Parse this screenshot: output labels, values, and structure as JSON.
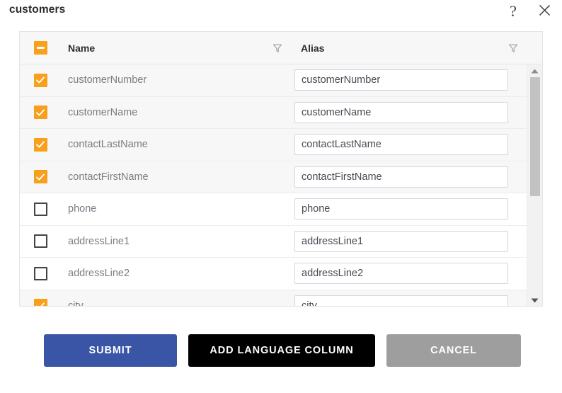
{
  "dialog": {
    "title": "customers",
    "help_icon": "question-mark-icon",
    "help_glyph": "?",
    "close_icon": "close-icon"
  },
  "table": {
    "select_all_state": "indeterminate",
    "columns": [
      {
        "key": "name",
        "label": "Name",
        "filter_icon": "filter-funnel-icon"
      },
      {
        "key": "alias",
        "label": "Alias",
        "filter_icon": "filter-funnel-icon"
      }
    ],
    "rows": [
      {
        "checked": true,
        "name": "customerNumber",
        "alias": "customerNumber"
      },
      {
        "checked": true,
        "name": "customerName",
        "alias": "customerName"
      },
      {
        "checked": true,
        "name": "contactLastName",
        "alias": "contactLastName"
      },
      {
        "checked": true,
        "name": "contactFirstName",
        "alias": "contactFirstName"
      },
      {
        "checked": false,
        "name": "phone",
        "alias": "phone"
      },
      {
        "checked": false,
        "name": "addressLine1",
        "alias": "addressLine1"
      },
      {
        "checked": false,
        "name": "addressLine2",
        "alias": "addressLine2"
      },
      {
        "checked": true,
        "name": "city",
        "alias": "city"
      }
    ],
    "scrollbar": {
      "up_icon": "scroll-up-arrow-icon",
      "down_icon": "scroll-down-arrow-icon",
      "thumb_position_percent": 0,
      "thumb_size_percent": 55
    }
  },
  "footer": {
    "submit_label": "SUBMIT",
    "add_language_column_label": "ADD LANGUAGE COLUMN",
    "cancel_label": "CANCEL"
  },
  "colors": {
    "accent_orange": "#f89f1b",
    "submit_blue": "#3b55a6",
    "add_language_black": "#000000",
    "cancel_gray": "#9e9e9e",
    "row_tint": "#f7f7f7",
    "text_muted": "#7c7c86"
  }
}
